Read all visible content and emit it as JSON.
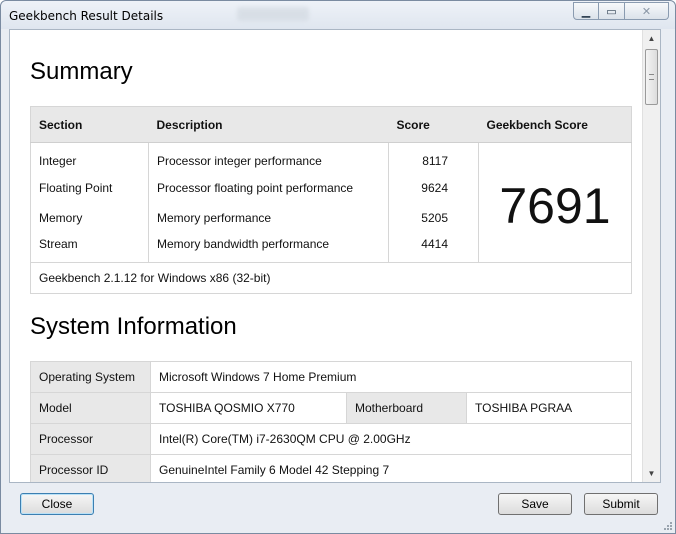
{
  "window": {
    "title": "Geekbench Result Details",
    "caption": {
      "min": "▁",
      "max": "▭",
      "close": "✕"
    }
  },
  "summary": {
    "title": "Summary",
    "headers": {
      "section": "Section",
      "description": "Description",
      "score": "Score",
      "geekbench_score": "Geekbench Score"
    },
    "rows": [
      {
        "section": "Integer",
        "description": "Processor integer performance",
        "score": "8117"
      },
      {
        "section": "Floating Point",
        "description": "Processor floating point performance",
        "score": "9624"
      },
      {
        "section": "Memory",
        "description": "Memory performance",
        "score": "5205"
      },
      {
        "section": "Stream",
        "description": "Memory bandwidth performance",
        "score": "4414"
      }
    ],
    "geekbench_score": "7691",
    "version": "Geekbench 2.1.12 for Windows x86 (32-bit)"
  },
  "system_info": {
    "title": "System Information",
    "os_label": "Operating System",
    "os_value": "Microsoft Windows 7 Home Premium",
    "model_label": "Model",
    "model_value": "TOSHIBA QOSMIO X770",
    "motherboard_label": "Motherboard",
    "motherboard_value": "TOSHIBA PGRAA",
    "processor_label": "Processor",
    "processor_value": "Intel(R) Core(TM) i7-2630QM CPU @ 2.00GHz",
    "processor_id_label": "Processor ID",
    "processor_id_value": "GenuineIntel Family 6 Model 42 Stepping 7"
  },
  "buttons": {
    "close": "Close",
    "save": "Save",
    "submit": "Submit"
  }
}
